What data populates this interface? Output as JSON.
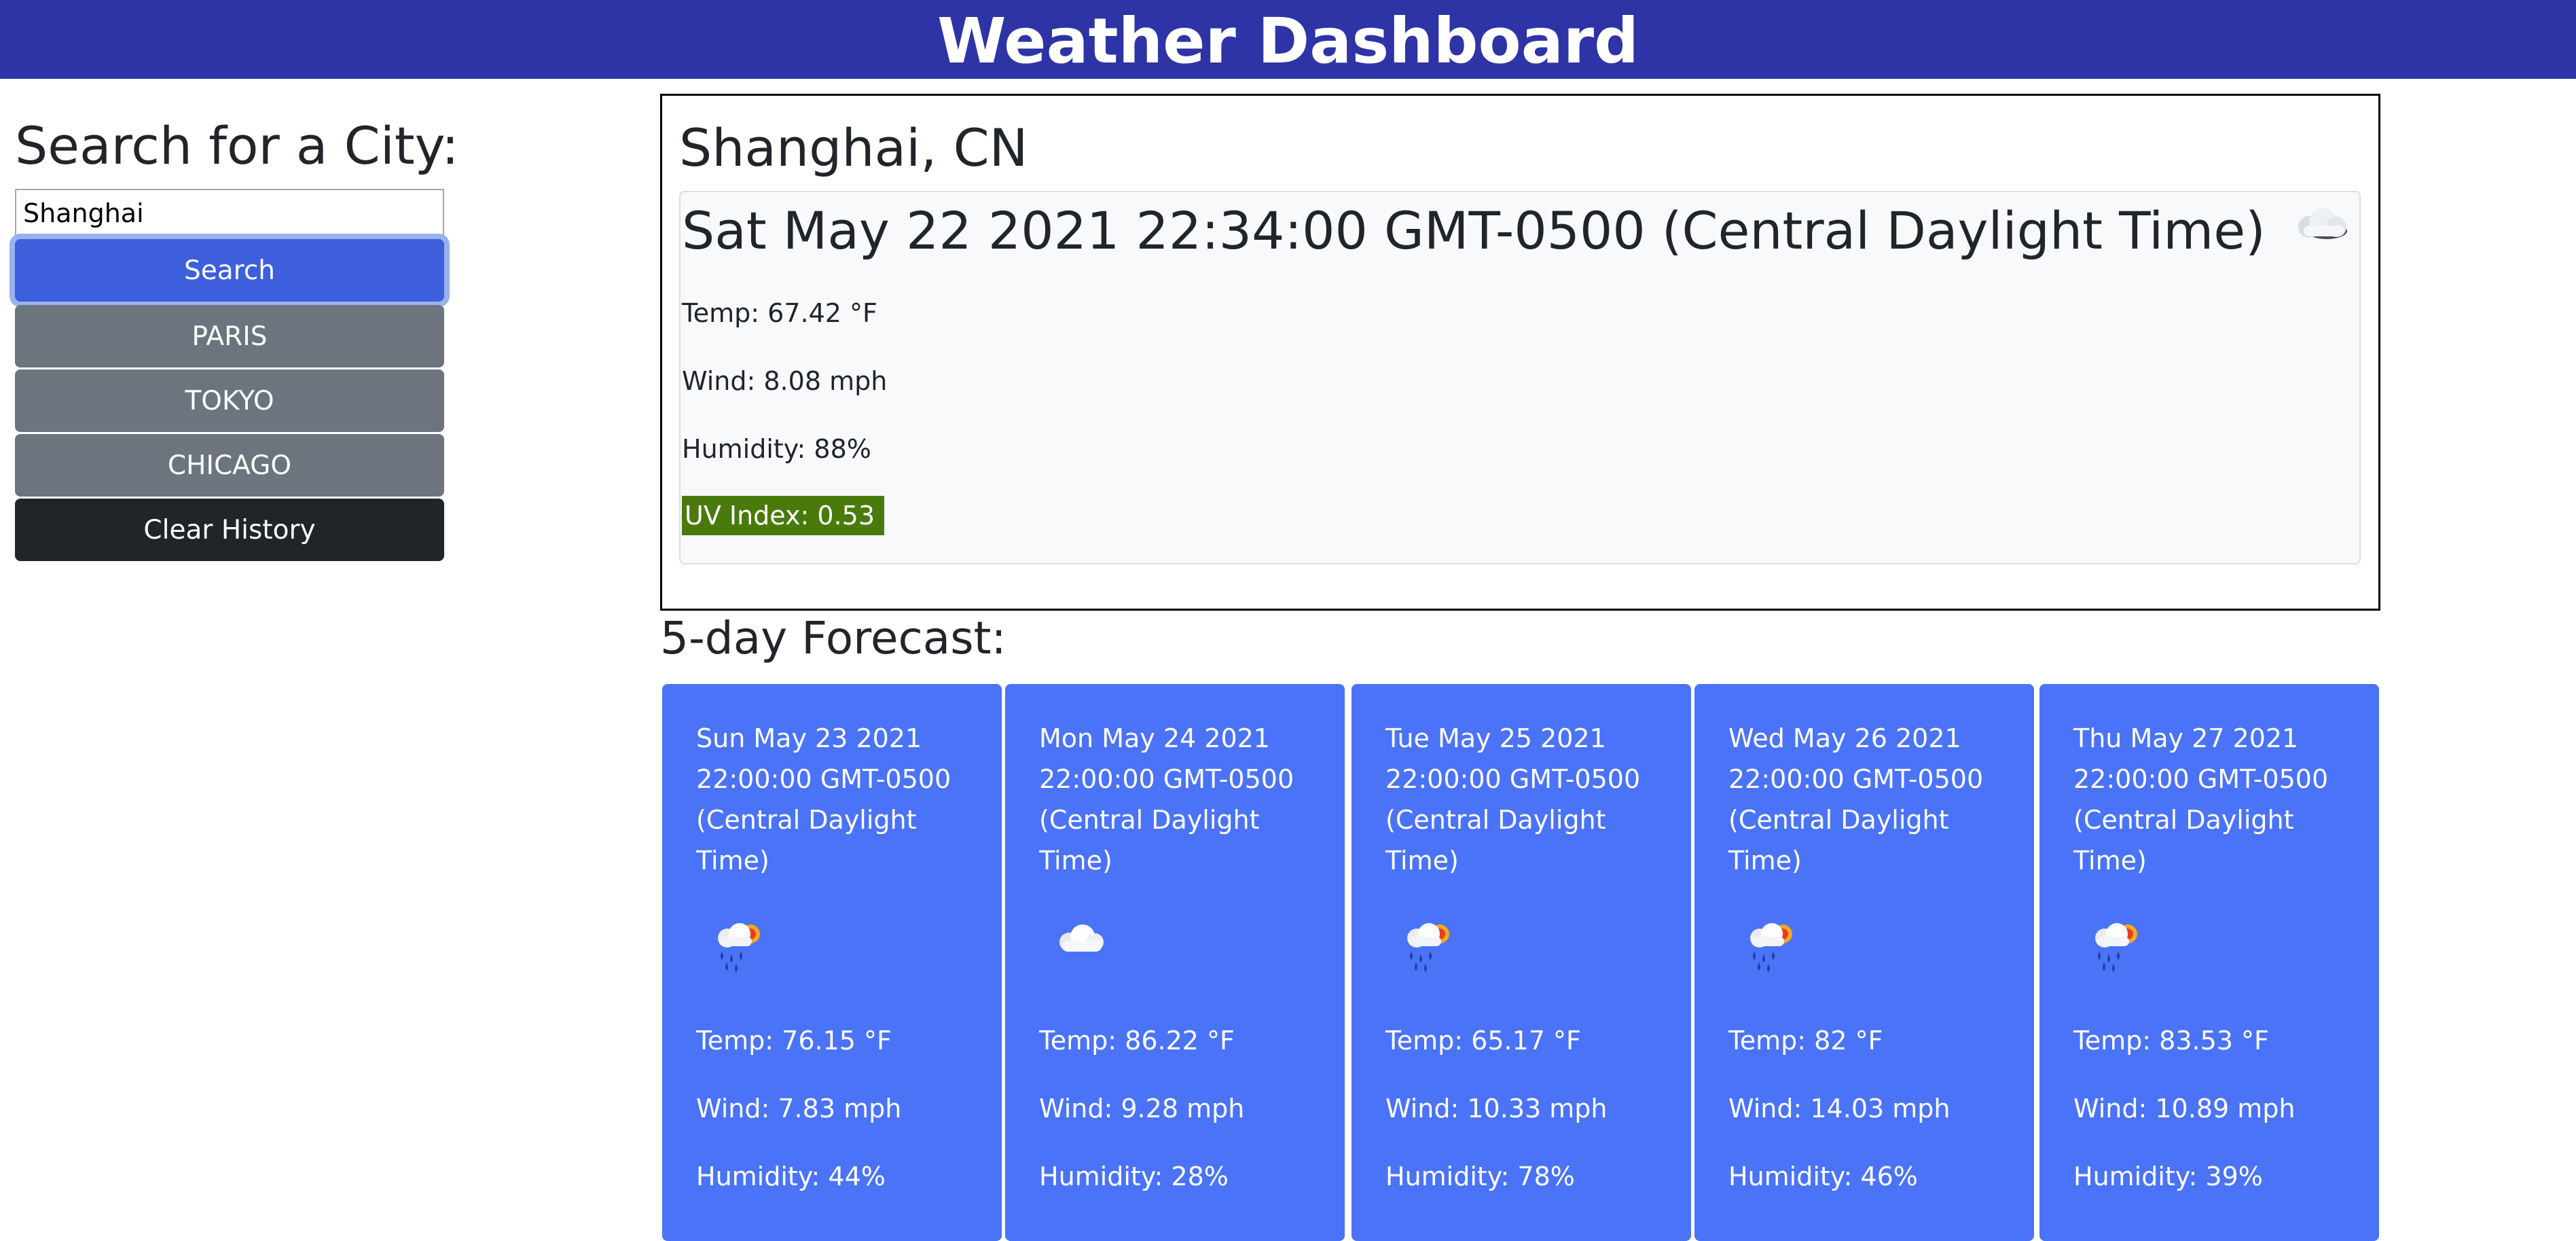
{
  "header": {
    "title": "Weather Dashboard"
  },
  "sidebar": {
    "heading": "Search for a City:",
    "search_value": "Shanghai",
    "search_label": "Search",
    "history": [
      "PARIS",
      "TOKYO",
      "CHICAGO"
    ],
    "clear_label": "Clear History"
  },
  "current": {
    "city": "Shanghai, CN",
    "date": "Sat May 22 2021 22:34:00 GMT-0500 (Central Daylight Time)",
    "icon": "cloud-icon",
    "temp": "Temp: 67.42 °F",
    "wind": "Wind: 8.08 mph",
    "humidity": "Humidity: 88%",
    "uv": "UV Index: 0.53",
    "uv_color": "#4a7a0b"
  },
  "forecast": {
    "heading": "5-day Forecast:",
    "card_color": "#4a73f7",
    "days": [
      {
        "date": "Sun May 23 2021 22:00:00 GMT-0500 (Central Daylight Time)",
        "icon": "rain-sun-icon",
        "temp": "Temp: 76.15 °F",
        "wind": "Wind: 7.83 mph",
        "humidity": "Humidity: 44%"
      },
      {
        "date": "Mon May 24 2021 22:00:00 GMT-0500 (Central Daylight Time)",
        "icon": "cloud-icon",
        "temp": "Temp: 86.22 °F",
        "wind": "Wind: 9.28 mph",
        "humidity": "Humidity: 28%"
      },
      {
        "date": "Tue May 25 2021 22:00:00 GMT-0500 (Central Daylight Time)",
        "icon": "rain-sun-icon",
        "temp": "Temp: 65.17 °F",
        "wind": "Wind: 10.33 mph",
        "humidity": "Humidity: 78%"
      },
      {
        "date": "Wed May 26 2021 22:00:00 GMT-0500 (Central Daylight Time)",
        "icon": "rain-sun-icon",
        "temp": "Temp: 82 °F",
        "wind": "Wind: 14.03 mph",
        "humidity": "Humidity: 46%"
      },
      {
        "date": "Thu May 27 2021 22:00:00 GMT-0500 (Central Daylight Time)",
        "icon": "rain-sun-icon",
        "temp": "Temp: 83.53 °F",
        "wind": "Wind: 10.89 mph",
        "humidity": "Humidity: 39%"
      }
    ]
  }
}
